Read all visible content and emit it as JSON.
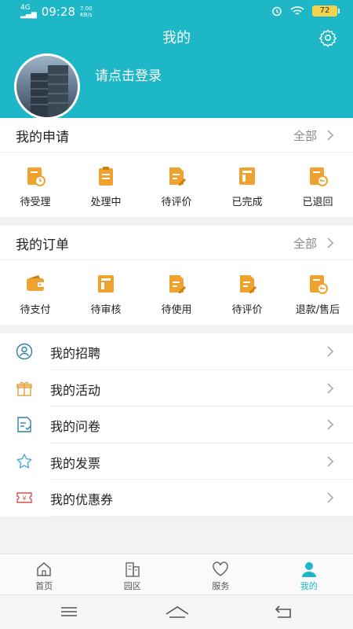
{
  "status_bar": {
    "network": "4G",
    "time": "09:28",
    "speed_value": "7.00",
    "speed_unit": "KB/s",
    "battery": "72"
  },
  "header": {
    "title": "我的",
    "login_prompt": "请点击登录"
  },
  "applications": {
    "title": "我的申请",
    "all_label": "全部",
    "items": [
      {
        "label": "待受理",
        "icon": "pending-accept-icon"
      },
      {
        "label": "处理中",
        "icon": "processing-icon"
      },
      {
        "label": "待评价",
        "icon": "to-review-icon"
      },
      {
        "label": "已完成",
        "icon": "completed-icon"
      },
      {
        "label": "已退回",
        "icon": "returned-icon"
      }
    ]
  },
  "orders": {
    "title": "我的订单",
    "all_label": "全部",
    "items": [
      {
        "label": "待支付",
        "icon": "wallet-icon"
      },
      {
        "label": "待审核",
        "icon": "audit-icon"
      },
      {
        "label": "待使用",
        "icon": "to-use-icon"
      },
      {
        "label": "待评价",
        "icon": "to-review-icon"
      },
      {
        "label": "退款/售后",
        "icon": "refund-icon"
      }
    ]
  },
  "menu": [
    {
      "label": "我的招聘",
      "icon": "user-icon"
    },
    {
      "label": "我的活动",
      "icon": "gift-icon"
    },
    {
      "label": "我的问卷",
      "icon": "questionnaire-icon"
    },
    {
      "label": "我的发票",
      "icon": "star-icon"
    },
    {
      "label": "我的优惠券",
      "icon": "coupon-icon"
    }
  ],
  "tabbar": [
    {
      "label": "首页",
      "icon": "home-icon"
    },
    {
      "label": "园区",
      "icon": "building-icon"
    },
    {
      "label": "服务",
      "icon": "heart-icon"
    },
    {
      "label": "我的",
      "icon": "profile-icon",
      "active": true
    }
  ],
  "colors": {
    "primary": "#1db7c7",
    "accent_orange": "#f0a22e"
  }
}
